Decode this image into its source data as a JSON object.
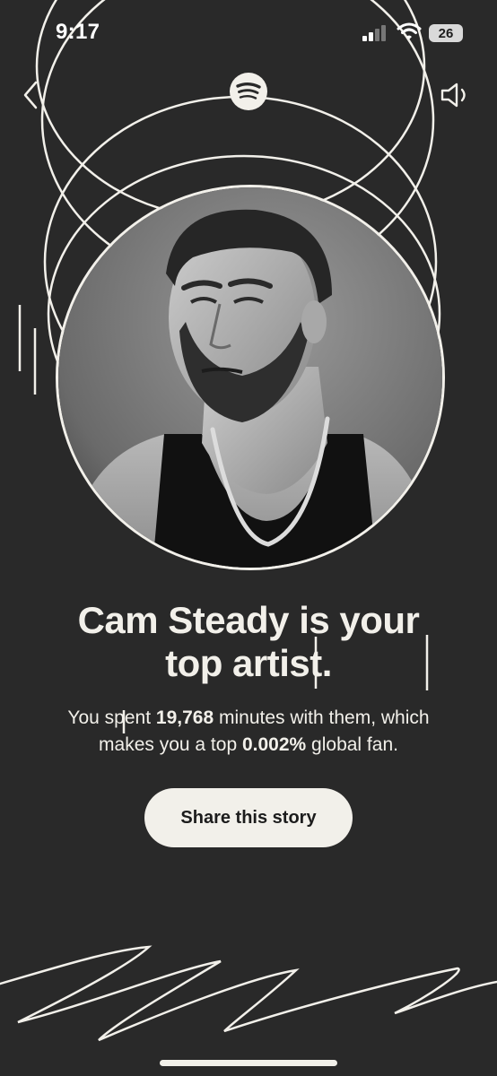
{
  "status_bar": {
    "time": "9:17",
    "battery_level": "26"
  },
  "nav": {
    "back_icon": "chevron-left-icon",
    "logo_icon": "spotify-logo-icon",
    "sound_icon": "speaker-icon"
  },
  "artist_photo": {
    "alt": "Cam Steady"
  },
  "headline": {
    "artist": "Cam Steady",
    "line1_suffix": "is your",
    "line2": "top artist."
  },
  "stats": {
    "prefix": "You spent",
    "minutes": "19,768",
    "middle": "minutes with them, which",
    "line2_prefix": "makes you a top",
    "percentile": "0.002%",
    "suffix": "global fan."
  },
  "share_button": {
    "label": "Share this story"
  },
  "colors": {
    "background": "#292929",
    "foreground": "#f2f0ea",
    "button_text": "#1c1c1c"
  }
}
